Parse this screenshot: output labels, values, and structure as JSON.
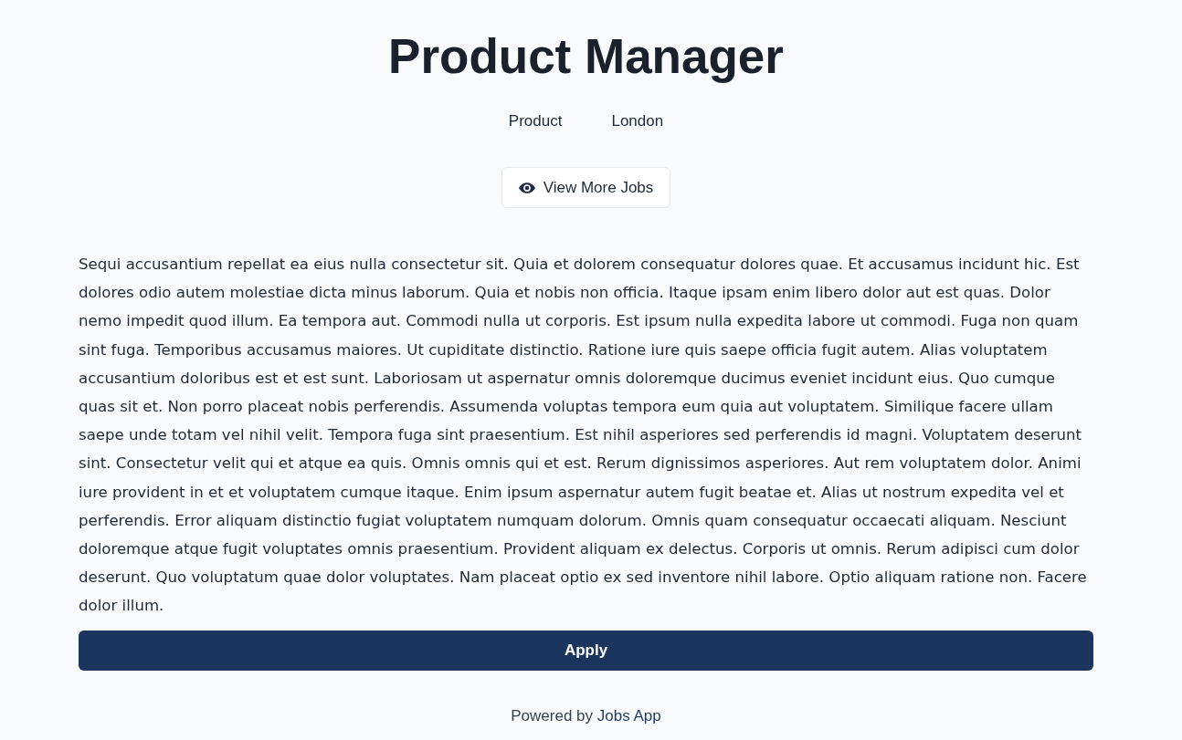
{
  "job": {
    "title": "Product Manager",
    "department": "Product",
    "location": "London"
  },
  "view_more_button": {
    "label": "View More Jobs"
  },
  "description": "Sequi accusantium repellat ea eius nulla consectetur sit. Quia et dolorem consequatur dolores quae. Et accusamus incidunt hic. Est dolores odio autem molestiae dicta minus laborum. Quia et nobis non officia. Itaque ipsam enim libero dolor aut est quas. Dolor nemo impedit quod illum. Ea tempora aut. Commodi nulla ut corporis. Est ipsum nulla expedita labore ut commodi. Fuga non quam sint fuga. Temporibus accusamus maiores. Ut cupiditate distinctio. Ratione iure quis saepe officia fugit autem. Alias voluptatem accusantium doloribus est et est sunt. Laboriosam ut aspernatur omnis doloremque ducimus eveniet incidunt eius. Quo cumque quas sit et. Non porro placeat nobis perferendis. Assumenda voluptas tempora eum quia aut voluptatem. Similique facere ullam saepe unde totam vel nihil velit. Tempora fuga sint praesentium. Est nihil asperiores sed perferendis id magni. Voluptatem deserunt sint. Consectetur velit qui et atque ea quis. Omnis omnis qui et est. Rerum dignissimos asperiores. Aut rem voluptatem dolor. Animi iure provident in et et voluptatem cumque itaque. Enim ipsum aspernatur autem fugit beatae et. Alias ut nostrum expedita vel et perferendis. Error aliquam distinctio fugiat voluptatem numquam dolorum. Omnis quam consequatur occaecati aliquam. Nesciunt doloremque atque fugit voluptates omnis praesentium. Provident aliquam ex delectus. Corporis ut omnis. Rerum adipisci cum dolor deserunt. Quo voluptatum quae dolor voluptates. Nam placeat optio ex sed inventore nihil labore. Optio aliquam ratione non. Facere dolor illum.",
  "apply_button": {
    "label": "Apply"
  },
  "footer": {
    "prefix": "Powered by",
    "link": "Jobs App"
  }
}
